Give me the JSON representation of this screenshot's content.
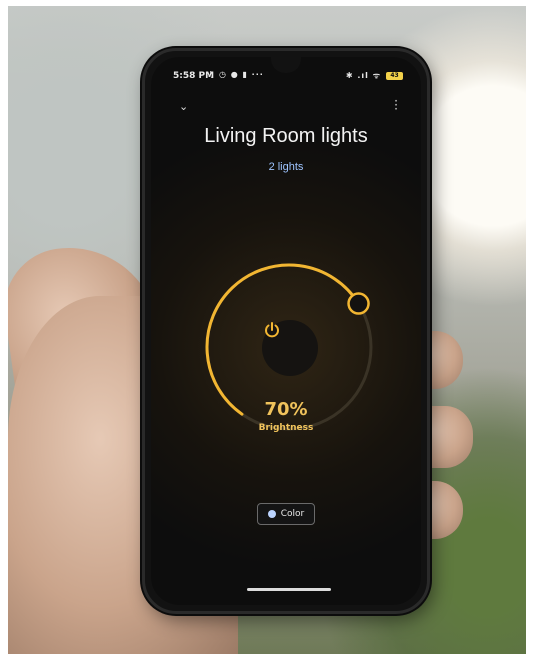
{
  "status_bar": {
    "time": "5:58 PM",
    "left_icons": "♫ ◷ ● ▮ ···",
    "right_icons": "✱ .ıl ᯤ",
    "battery": "43"
  },
  "header": {
    "back_icon": "chevron-down-icon",
    "menu_icon": "more-vert-icon",
    "title": "Living Room lights",
    "subtitle": "2 lights"
  },
  "dial": {
    "brightness_value": 0.7,
    "brightness_text": "70%",
    "brightness_label": "Brightness",
    "accent_color": "#f2b632",
    "power_icon": "power-icon"
  },
  "color_button": {
    "label": "Color",
    "icon": "palette-icon"
  }
}
